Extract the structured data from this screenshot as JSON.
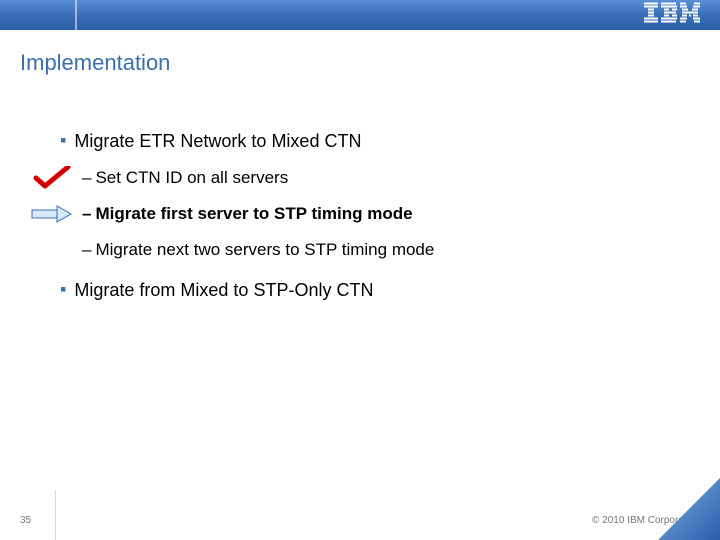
{
  "logo": "IBM",
  "title": "Implementation",
  "main1": {
    "text": "Migrate ETR Network to Mixed CTN",
    "sub1": "Set CTN ID on all servers",
    "sub2": "Migrate first server to STP timing mode",
    "sub3": "Migrate next two servers to STP timing mode"
  },
  "main2": {
    "text": "Migrate from Mixed to STP-Only CTN"
  },
  "pageNumber": "35",
  "copyright": "© 2010 IBM Corporation"
}
